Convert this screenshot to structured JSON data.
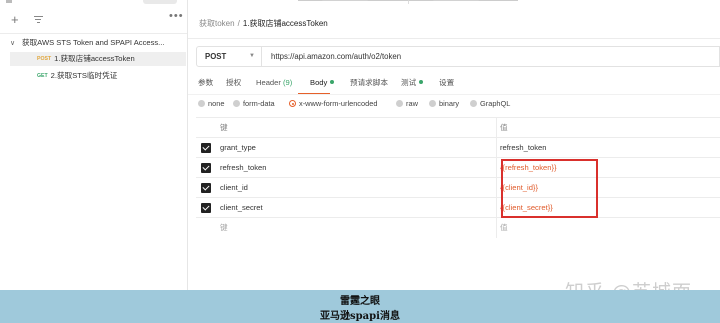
{
  "sidebar": {
    "folder": "获取AWS STS Token and SPAPI Access...",
    "items": [
      {
        "method": "POST",
        "label": "1.获取店铺accessToken"
      },
      {
        "method": "GET",
        "label": "2.获取STS临时凭证"
      }
    ]
  },
  "breadcrumb": {
    "parent": "获取token",
    "separator": "/",
    "current": "1.获取店铺accessToken"
  },
  "request": {
    "method": "POST",
    "url": "https://api.amazon.com/auth/o2/token"
  },
  "tabs": [
    {
      "label": "参数"
    },
    {
      "label": "授权"
    },
    {
      "label": "Header",
      "count": "(9)"
    },
    {
      "label": "Body",
      "active": true
    },
    {
      "label": "预请求脚本"
    },
    {
      "label": "测试"
    },
    {
      "label": "设置"
    }
  ],
  "body_types": [
    "none",
    "form-data",
    "x-www-form-urlencoded",
    "raw",
    "binary",
    "GraphQL"
  ],
  "body_type_selected": "x-www-form-urlencoded",
  "params_table": {
    "headers": {
      "key": "键",
      "value": "值"
    },
    "rows": [
      {
        "key": "grant_type",
        "value": "refresh_token"
      },
      {
        "key": "refresh_token",
        "value": "{{refresh_token}}"
      },
      {
        "key": "client_id",
        "value": "{{client_id}}"
      },
      {
        "key": "client_secret",
        "value": "{{client_secret}}"
      }
    ],
    "placeholder": {
      "key": "键",
      "value": "值"
    }
  },
  "watermark": "知乎 @苏城面",
  "banner": {
    "line1": "雷霆之眼",
    "line2": "亚马逊spapi消息"
  },
  "colors": {
    "accent": "#e6602a",
    "post": "#e0a63c",
    "get": "#3aa56a",
    "variable": "#e05a2a",
    "highlight": "#d9302c",
    "banner": "#9fc9db"
  }
}
